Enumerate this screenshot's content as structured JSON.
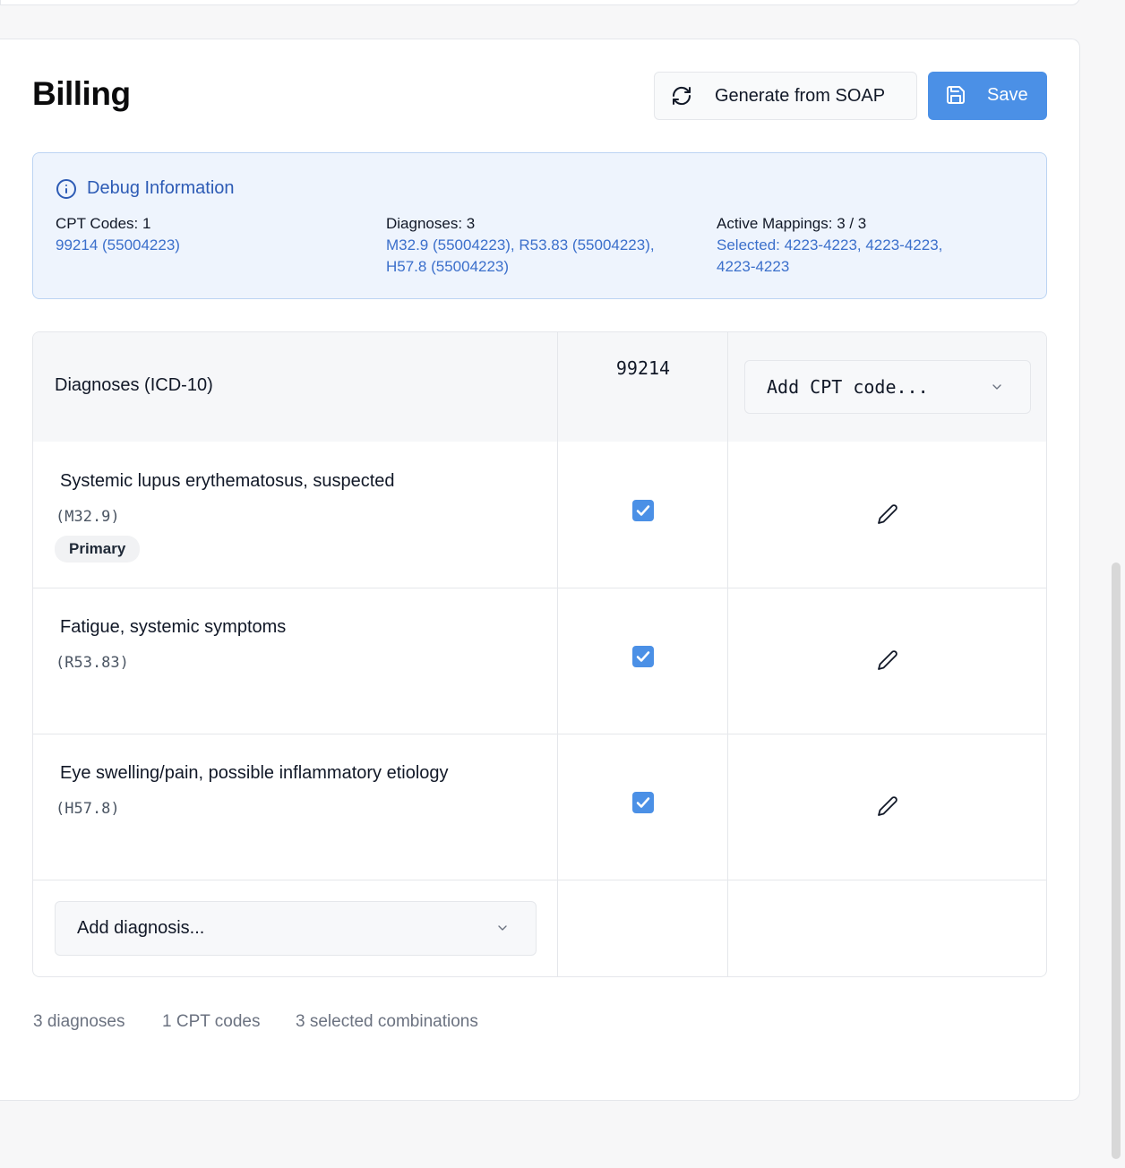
{
  "billing": {
    "title": "Billing",
    "generate_label": "Generate from SOAP",
    "save_label": "Save"
  },
  "debug": {
    "title": "Debug Information",
    "cpt_key": "CPT Codes:",
    "cpt_count": "1",
    "cpt_value": "99214 (55004223)",
    "dx_key": "Diagnoses:",
    "dx_count": "3",
    "dx_value_1": "M32.9 (55004223), R53.83 (55004223),",
    "dx_value_2": "H57.8 (55004223)",
    "map_key": "Active Mappings:",
    "map_count": "3 / 3",
    "map_value_1": "Selected: 4223-4223, 4223-4223,",
    "map_value_2": "4223-4223"
  },
  "table": {
    "dx_header": "Diagnoses (ICD-10)",
    "cpt_code": "99214",
    "add_cpt_placeholder": "Add CPT code...",
    "rows": [
      {
        "name": "Systemic lupus erythematosus, suspected",
        "code": "(M32.9)",
        "badge": "Primary",
        "checked": true
      },
      {
        "name": "Fatigue, systemic symptoms",
        "code": "(R53.83)",
        "checked": true
      },
      {
        "name": "Eye swelling/pain, possible inflammatory etiology",
        "code": "(H57.8)",
        "checked": true
      }
    ],
    "add_dx_placeholder": "Add diagnosis..."
  },
  "summary": {
    "diagnoses": "3 diagnoses",
    "cpt": "1 CPT codes",
    "combos": "3 selected combinations"
  },
  "colors": {
    "accent": "#4b90e6",
    "debug_bg": "#eef4fd",
    "debug_text": "#3b6fcb"
  },
  "icons": [
    "refresh-icon",
    "save-icon",
    "info-icon",
    "chevron-down-icon",
    "checkbox-checked-icon",
    "pencil-icon"
  ]
}
